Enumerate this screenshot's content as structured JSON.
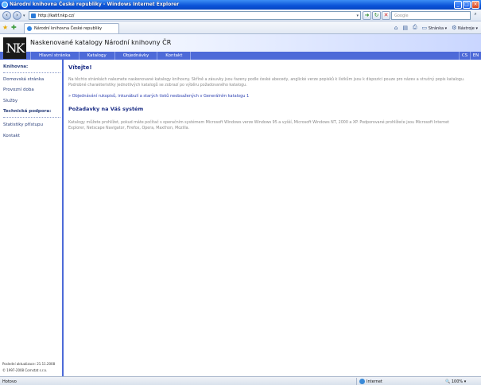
{
  "window": {
    "title": "Národní knihovna České republiky - Windows Internet Explorer",
    "controls": [
      "_",
      "□",
      "×"
    ]
  },
  "address_bar": {
    "url": "http://katif.nkp.cz/",
    "search_placeholder": "Google"
  },
  "tab_bar": {
    "tab_label": "Národní knihovna České republiky",
    "page_menu": "Stránka",
    "tools_menu": "Nástroje"
  },
  "site": {
    "logo_text": "NK",
    "title": "Naskenované katalogy Národní knihovny ČR",
    "menu": [
      "Hlavní stránka",
      "Katalogy",
      "Objednávky",
      "Kontakt"
    ],
    "languages": [
      "CS",
      "EN"
    ]
  },
  "sidebar": {
    "heading_library": "Knihovna:",
    "items_library": [
      "Domovská stránka",
      "Provozní doba",
      "Služby"
    ],
    "heading_support": "Technická podpora:",
    "items_support": [
      "Statistiky přístupu",
      "Kontakt"
    ],
    "footer_updated": "Poslední aktualizace: 21.11.2008",
    "footer_copyright": "© 1997-2008 Cornstat s.r.o."
  },
  "main": {
    "welcome": "Vítejte!",
    "intro": "Na těchto stránkách naleznete naskenované katalogy knihovny. Skříně a zásuvky jsou řazeny podle české abecedy, anglické verze popisků k lístkům jsou k dispozici pouze pro název a stručný popis katalogu. Podrobné charakteristiky jednotlivých katalogů se zobrazí po výběru požadovaného katalogu.",
    "order_link_arrow": "»",
    "order_link": "Objednávání rukopisů, inkunábulí a starých tisků neobsažených v Generálním katalogu 1",
    "requirements_heading": "Požadavky na Váš systém",
    "requirements_text": "Katalogy můžete prohlížet, pokud máte počítač s operačním systémem Microsoft Windows verze Windows 95 a vyšší, Microsoft Windows NT, 2000 a XP. Podporované prohlížeče jsou Microsoft Internet Explorer, Netscape Navigator, Firefox, Opera, Maxthon, Mozilla."
  },
  "status_bar": {
    "status": "Hotovo",
    "zone": "Internet",
    "zoom": "100%"
  }
}
